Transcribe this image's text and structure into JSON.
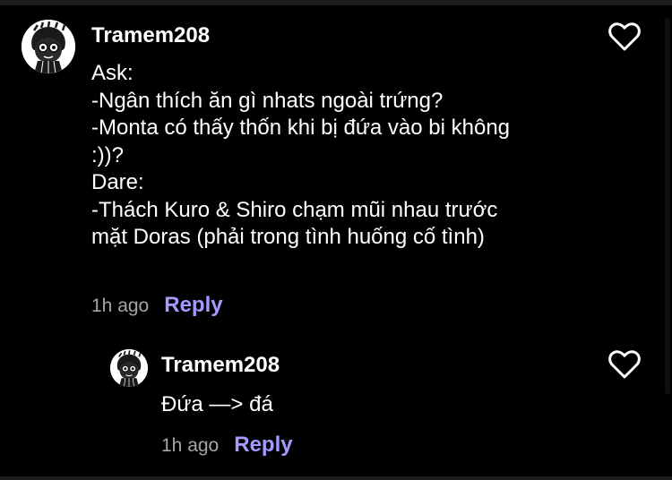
{
  "thread": {
    "comment": {
      "author": "Tramem208",
      "lines": [
        "Ask:",
        "-Ngân thích ăn gì nhats ngoài trứng?",
        "-Monta có thấy thốn khi bị đứa vào bi không",
        ":))?",
        "Dare:",
        "-Thách Kuro & Shiro chạm mũi nhau trước",
        "mặt Doras (phải trong tình huống cố tình)"
      ],
      "time": "1h ago",
      "reply_label": "Reply",
      "like_icon": "heart-outline-icon",
      "avatar_icon": "cartoon-face-avatar"
    },
    "reply": {
      "author": "Tramem208",
      "lines": [
        "Đứa —> đá"
      ],
      "time": "1h ago",
      "reply_label": "Reply",
      "like_icon": "heart-outline-icon",
      "avatar_icon": "cartoon-face-avatar"
    }
  },
  "colors": {
    "background": "#000000",
    "text": "#ffffff",
    "timestamp": "#a6a6a6",
    "reply_link": "#a49bff"
  }
}
